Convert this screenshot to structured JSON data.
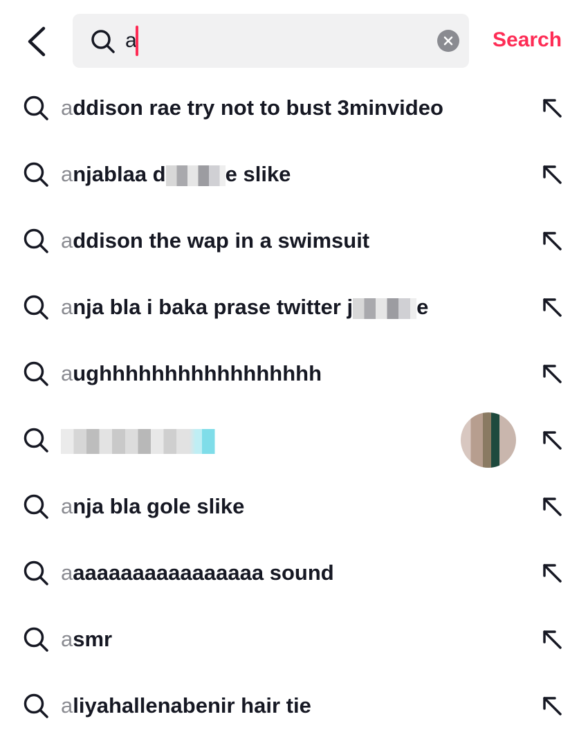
{
  "header": {
    "back_icon": "chevron-left-icon",
    "search_value": "a",
    "clear_icon": "close-icon",
    "search_action_label": "Search"
  },
  "colors": {
    "accent": "#fe2c55",
    "text": "#161823",
    "muted": "#8a8b91",
    "input_bg": "#f1f1f2"
  },
  "suggestions": [
    {
      "first": "a",
      "rest": "ddison rae try not to bust 3minvideo"
    },
    {
      "first": "a",
      "rest_before": "njablaa d",
      "rest_after": "e slike",
      "redacted": true
    },
    {
      "first": "a",
      "rest": "ddison the wap in a swimsuit"
    },
    {
      "first": "a",
      "rest_before": "nja bla i baka prase twitter j",
      "rest_after": "e",
      "redacted": true
    },
    {
      "first": "a",
      "rest": "ughhhhhhhhhhhhhhhhh"
    },
    {
      "first": "",
      "rest": "",
      "redacted_full": true,
      "has_avatar": true
    },
    {
      "first": "a",
      "rest": "nja bla gole slike"
    },
    {
      "first": "a",
      "rest": "aaaaaaaaaaaaaaaa sound"
    },
    {
      "first": "a",
      "rest": "smr"
    },
    {
      "first": "a",
      "rest": "liyahallenabenir hair tie"
    }
  ],
  "row_icon": "search-icon",
  "row_action_icon": "arrow-up-left-icon"
}
